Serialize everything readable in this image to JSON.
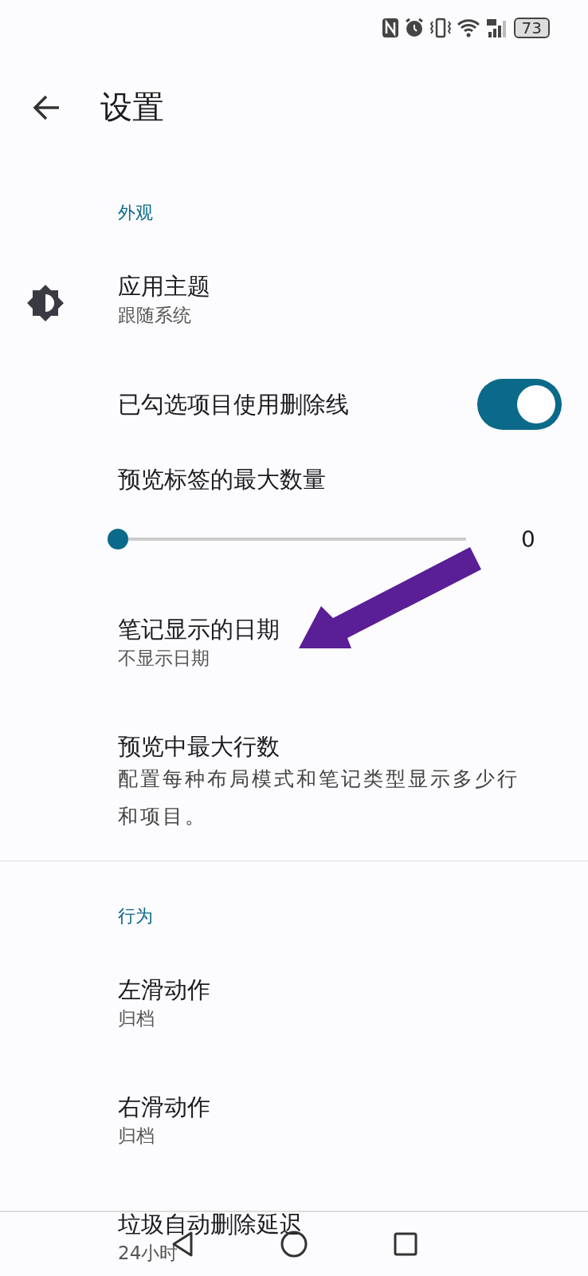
{
  "status_bar": {
    "battery": "73"
  },
  "header": {
    "title": "设置"
  },
  "sections": [
    {
      "title": "外观",
      "items": [
        {
          "kind": "icon-option",
          "title": "应用主题",
          "subtitle": "跟随系统"
        },
        {
          "kind": "switch",
          "title": "已勾选项目使用删除线",
          "on": true
        },
        {
          "kind": "slider",
          "title": "预览标签的最大数量",
          "level": 0,
          "reading": "0"
        },
        {
          "kind": "option",
          "title": "笔记显示的日期",
          "subtitle": "不显示日期"
        },
        {
          "kind": "description",
          "title": "预览中最大行数",
          "subtitle": "配置每种布局模式和笔记类型显示多少行和项目。"
        }
      ]
    },
    {
      "title": "行为",
      "items": [
        {
          "kind": "option",
          "title": "左滑动作",
          "subtitle": "归档"
        },
        {
          "kind": "option",
          "title": "右滑动作",
          "subtitle": "归档"
        },
        {
          "kind": "option",
          "title": "垃圾自动删除延迟",
          "subtitle": "24小时"
        }
      ]
    }
  ]
}
